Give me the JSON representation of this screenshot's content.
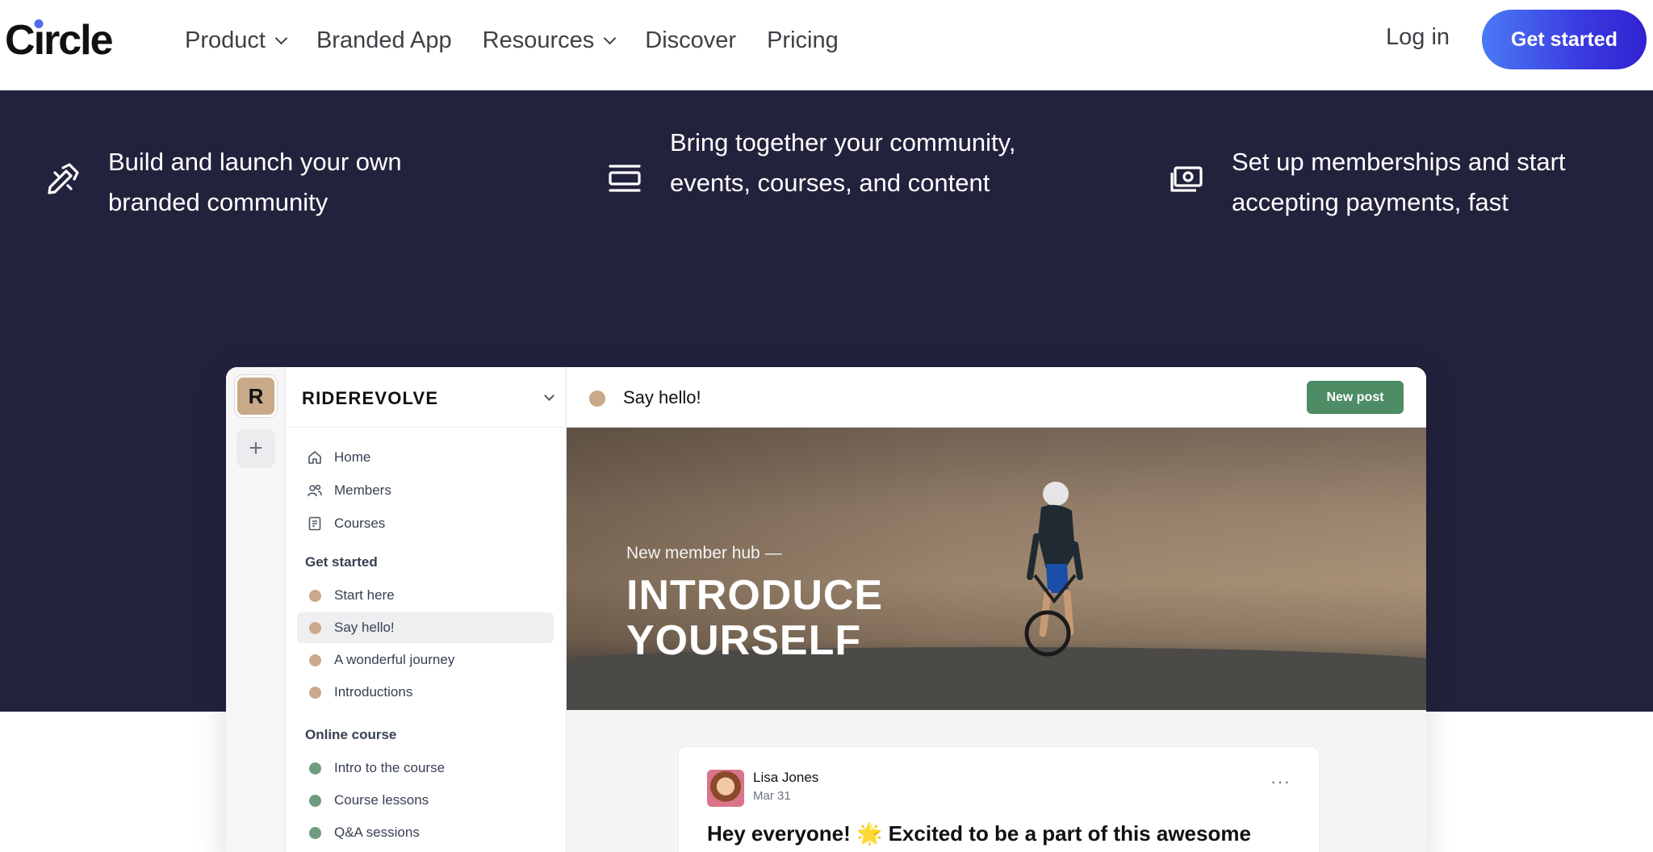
{
  "nav": {
    "logo": "Circle",
    "items": [
      {
        "label": "Product",
        "has_menu": true
      },
      {
        "label": "Branded App",
        "has_menu": false
      },
      {
        "label": "Resources",
        "has_menu": true
      },
      {
        "label": "Discover",
        "has_menu": false
      },
      {
        "label": "Pricing",
        "has_menu": false
      }
    ],
    "login": "Log in",
    "cta": "Get started"
  },
  "features": [
    {
      "icon": "pen-ruler-icon",
      "text": "Build and launch your own branded community"
    },
    {
      "icon": "stacked-layers-icon",
      "text": "Bring together your community, events, courses, and content"
    },
    {
      "icon": "money-icon",
      "text": "Set up memberships and start accepting payments, fast"
    }
  ],
  "app": {
    "brand": "RIDEREVOLVE",
    "rail_logo": "R",
    "rail_add": "+",
    "nav_items": [
      {
        "icon": "home-icon",
        "label": "Home"
      },
      {
        "icon": "members-icon",
        "label": "Members"
      },
      {
        "icon": "courses-icon",
        "label": "Courses"
      }
    ],
    "sections": [
      {
        "heading": "Get started",
        "color": "#c8a98a",
        "items": [
          "Start here",
          "Say hello!",
          "A wonderful journey",
          "Introductions"
        ],
        "active": "Say hello!"
      },
      {
        "heading": "Online course",
        "color": "#6f9c80",
        "items": [
          "Intro to the course",
          "Course lessons",
          "Q&A sessions"
        ]
      }
    ],
    "header_title": "Say hello!",
    "new_post": "New post",
    "hero": {
      "subtitle": "New member hub —",
      "title_line1": "INTRODUCE",
      "title_line2": "YOURSELF"
    },
    "post": {
      "author": "Lisa Jones",
      "date": "Mar 31",
      "menu": "···",
      "text": "Hey everyone! 🌟 Excited to be a part of this awesome"
    }
  },
  "colors": {
    "band": "#23223d",
    "cta_gradient_start": "#4a7af5",
    "cta_gradient_end": "#3022d0",
    "new_post": "#4d8c65",
    "logo_dot": "#506cf0"
  }
}
